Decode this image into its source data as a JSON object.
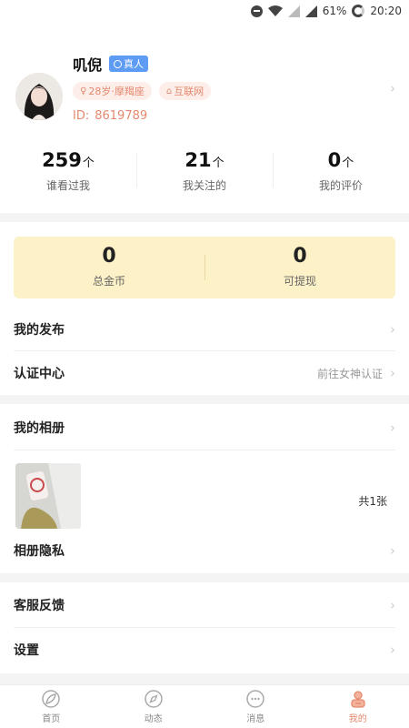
{
  "status_bar": {
    "battery": "61%",
    "time": "20:20"
  },
  "profile": {
    "name": "叽倪",
    "real_badge": "真人",
    "tags": [
      "28岁·摩羯座",
      "互联网"
    ],
    "id_label": "ID:",
    "id_value": "8619789"
  },
  "stats": [
    {
      "value": "259",
      "unit": "个",
      "label": "谁看过我"
    },
    {
      "value": "21",
      "unit": "个",
      "label": "我关注的"
    },
    {
      "value": "0",
      "unit": "个",
      "label": "我的评价"
    }
  ],
  "wallet": [
    {
      "value": "0",
      "label": "总金币"
    },
    {
      "value": "0",
      "label": "可提现"
    }
  ],
  "menu": {
    "my_posts": "我的发布",
    "verify_center": "认证中心",
    "verify_hint": "前往女神认证",
    "my_album": "我的相册",
    "album_count": "共1张",
    "album_privacy": "相册隐私",
    "feedback": "客服反馈",
    "settings": "设置"
  },
  "tabbar": [
    {
      "label": "首页",
      "icon": "home-leaf-icon"
    },
    {
      "label": "动态",
      "icon": "compass-icon"
    },
    {
      "label": "消息",
      "icon": "chat-bubble-icon"
    },
    {
      "label": "我的",
      "icon": "profile-icon",
      "active": true
    }
  ],
  "colors": {
    "accent": "#e4896f",
    "wallet_bg": "#fcf1c7",
    "badge": "#5d9bf5"
  }
}
